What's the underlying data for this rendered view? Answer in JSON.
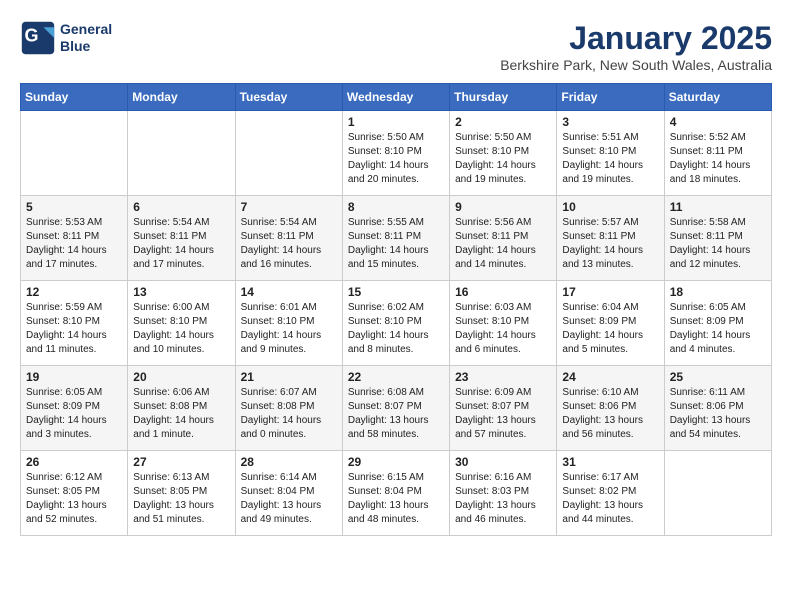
{
  "header": {
    "logo_line1": "General",
    "logo_line2": "Blue",
    "month": "January 2025",
    "location": "Berkshire Park, New South Wales, Australia"
  },
  "weekdays": [
    "Sunday",
    "Monday",
    "Tuesday",
    "Wednesday",
    "Thursday",
    "Friday",
    "Saturday"
  ],
  "weeks": [
    [
      {
        "day": "",
        "info": ""
      },
      {
        "day": "",
        "info": ""
      },
      {
        "day": "",
        "info": ""
      },
      {
        "day": "1",
        "info": "Sunrise: 5:50 AM\nSunset: 8:10 PM\nDaylight: 14 hours\nand 20 minutes."
      },
      {
        "day": "2",
        "info": "Sunrise: 5:50 AM\nSunset: 8:10 PM\nDaylight: 14 hours\nand 19 minutes."
      },
      {
        "day": "3",
        "info": "Sunrise: 5:51 AM\nSunset: 8:10 PM\nDaylight: 14 hours\nand 19 minutes."
      },
      {
        "day": "4",
        "info": "Sunrise: 5:52 AM\nSunset: 8:11 PM\nDaylight: 14 hours\nand 18 minutes."
      }
    ],
    [
      {
        "day": "5",
        "info": "Sunrise: 5:53 AM\nSunset: 8:11 PM\nDaylight: 14 hours\nand 17 minutes."
      },
      {
        "day": "6",
        "info": "Sunrise: 5:54 AM\nSunset: 8:11 PM\nDaylight: 14 hours\nand 17 minutes."
      },
      {
        "day": "7",
        "info": "Sunrise: 5:54 AM\nSunset: 8:11 PM\nDaylight: 14 hours\nand 16 minutes."
      },
      {
        "day": "8",
        "info": "Sunrise: 5:55 AM\nSunset: 8:11 PM\nDaylight: 14 hours\nand 15 minutes."
      },
      {
        "day": "9",
        "info": "Sunrise: 5:56 AM\nSunset: 8:11 PM\nDaylight: 14 hours\nand 14 minutes."
      },
      {
        "day": "10",
        "info": "Sunrise: 5:57 AM\nSunset: 8:11 PM\nDaylight: 14 hours\nand 13 minutes."
      },
      {
        "day": "11",
        "info": "Sunrise: 5:58 AM\nSunset: 8:11 PM\nDaylight: 14 hours\nand 12 minutes."
      }
    ],
    [
      {
        "day": "12",
        "info": "Sunrise: 5:59 AM\nSunset: 8:10 PM\nDaylight: 14 hours\nand 11 minutes."
      },
      {
        "day": "13",
        "info": "Sunrise: 6:00 AM\nSunset: 8:10 PM\nDaylight: 14 hours\nand 10 minutes."
      },
      {
        "day": "14",
        "info": "Sunrise: 6:01 AM\nSunset: 8:10 PM\nDaylight: 14 hours\nand 9 minutes."
      },
      {
        "day": "15",
        "info": "Sunrise: 6:02 AM\nSunset: 8:10 PM\nDaylight: 14 hours\nand 8 minutes."
      },
      {
        "day": "16",
        "info": "Sunrise: 6:03 AM\nSunset: 8:10 PM\nDaylight: 14 hours\nand 6 minutes."
      },
      {
        "day": "17",
        "info": "Sunrise: 6:04 AM\nSunset: 8:09 PM\nDaylight: 14 hours\nand 5 minutes."
      },
      {
        "day": "18",
        "info": "Sunrise: 6:05 AM\nSunset: 8:09 PM\nDaylight: 14 hours\nand 4 minutes."
      }
    ],
    [
      {
        "day": "19",
        "info": "Sunrise: 6:05 AM\nSunset: 8:09 PM\nDaylight: 14 hours\nand 3 minutes."
      },
      {
        "day": "20",
        "info": "Sunrise: 6:06 AM\nSunset: 8:08 PM\nDaylight: 14 hours\nand 1 minute."
      },
      {
        "day": "21",
        "info": "Sunrise: 6:07 AM\nSunset: 8:08 PM\nDaylight: 14 hours\nand 0 minutes."
      },
      {
        "day": "22",
        "info": "Sunrise: 6:08 AM\nSunset: 8:07 PM\nDaylight: 13 hours\nand 58 minutes."
      },
      {
        "day": "23",
        "info": "Sunrise: 6:09 AM\nSunset: 8:07 PM\nDaylight: 13 hours\nand 57 minutes."
      },
      {
        "day": "24",
        "info": "Sunrise: 6:10 AM\nSunset: 8:06 PM\nDaylight: 13 hours\nand 56 minutes."
      },
      {
        "day": "25",
        "info": "Sunrise: 6:11 AM\nSunset: 8:06 PM\nDaylight: 13 hours\nand 54 minutes."
      }
    ],
    [
      {
        "day": "26",
        "info": "Sunrise: 6:12 AM\nSunset: 8:05 PM\nDaylight: 13 hours\nand 52 minutes."
      },
      {
        "day": "27",
        "info": "Sunrise: 6:13 AM\nSunset: 8:05 PM\nDaylight: 13 hours\nand 51 minutes."
      },
      {
        "day": "28",
        "info": "Sunrise: 6:14 AM\nSunset: 8:04 PM\nDaylight: 13 hours\nand 49 minutes."
      },
      {
        "day": "29",
        "info": "Sunrise: 6:15 AM\nSunset: 8:04 PM\nDaylight: 13 hours\nand 48 minutes."
      },
      {
        "day": "30",
        "info": "Sunrise: 6:16 AM\nSunset: 8:03 PM\nDaylight: 13 hours\nand 46 minutes."
      },
      {
        "day": "31",
        "info": "Sunrise: 6:17 AM\nSunset: 8:02 PM\nDaylight: 13 hours\nand 44 minutes."
      },
      {
        "day": "",
        "info": ""
      }
    ]
  ]
}
